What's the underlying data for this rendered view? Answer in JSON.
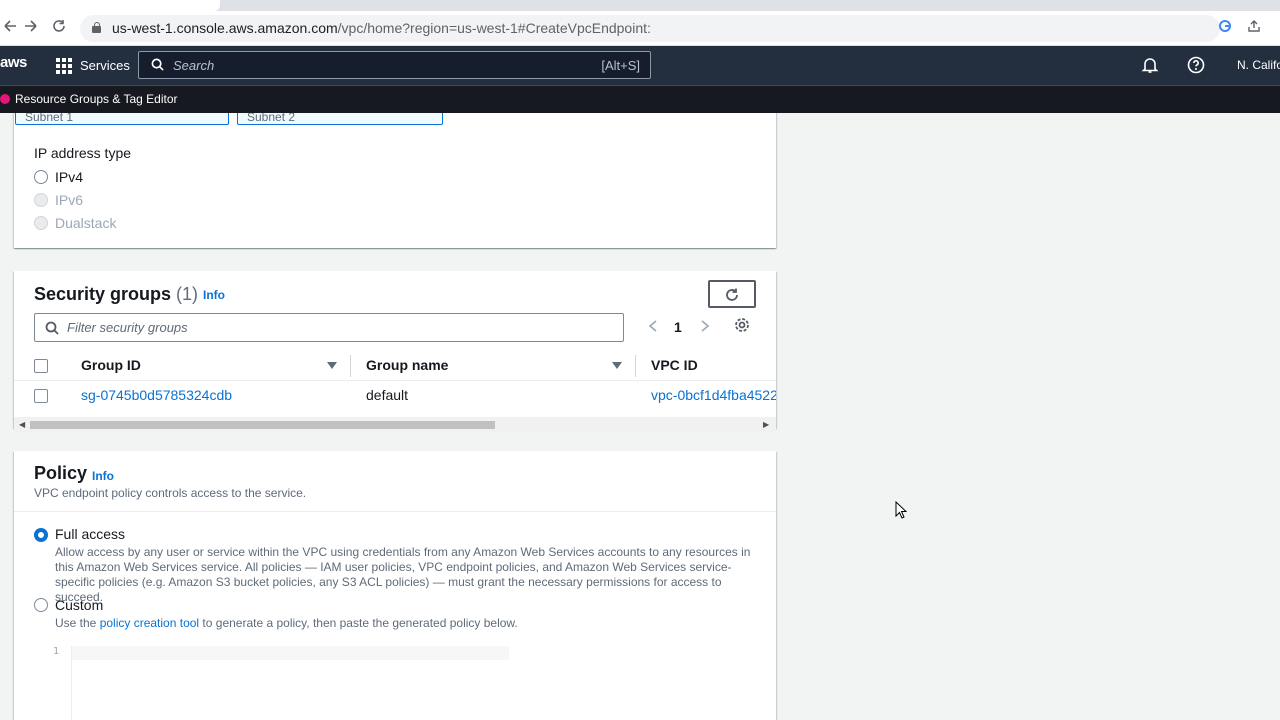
{
  "browser": {
    "url_host": "us-west-1.console.aws.amazon.com",
    "url_path": "/vpc/home?region=us-west-1#CreateVpcEndpoint:"
  },
  "aws": {
    "logo": "aws",
    "services_label": "Services",
    "search_placeholder": "Search",
    "search_shortcut": "[Alt+S]",
    "region": "N. Califo",
    "favorite": "Resource Groups & Tag Editor"
  },
  "subnets": {
    "tokens": [
      {
        "label": "Subnet 1"
      },
      {
        "label": "Subnet 2"
      }
    ]
  },
  "ip_address_type": {
    "label": "IP address type",
    "options": [
      {
        "label": "IPv4",
        "enabled": true,
        "selected": false
      },
      {
        "label": "IPv6",
        "enabled": false,
        "selected": false
      },
      {
        "label": "Dualstack",
        "enabled": false,
        "selected": false
      }
    ]
  },
  "security_groups": {
    "title": "Security groups",
    "count": "(1)",
    "info": "Info",
    "filter_placeholder": "Filter security groups",
    "page": "1",
    "columns": [
      "Group ID",
      "Group name",
      "VPC ID"
    ],
    "rows": [
      {
        "group_id": "sg-0745b0d5785324cdb",
        "group_name": "default",
        "vpc_id": "vpc-0bcf1d4fba4522"
      }
    ]
  },
  "policy": {
    "title": "Policy",
    "info": "Info",
    "description": "VPC endpoint policy controls access to the service.",
    "full_access": {
      "label": "Full access",
      "description": "Allow access by any user or service within the VPC using credentials from any Amazon Web Services accounts to any resources in this Amazon Web Services service. All policies — IAM user policies, VPC endpoint policies, and Amazon Web Services service-specific policies (e.g. Amazon S3 bucket policies, any S3 ACL policies) — must grant the necessary permissions for access to succeed."
    },
    "custom": {
      "label": "Custom",
      "desc_prefix": "Use the ",
      "desc_link": "policy creation tool",
      "desc_suffix": " to generate a policy, then paste the generated policy below."
    },
    "editor_line": "1"
  },
  "colors": {
    "accent": "#0972d3",
    "nav_bg": "#232f3e",
    "page_bg": "#f2f3f3"
  }
}
